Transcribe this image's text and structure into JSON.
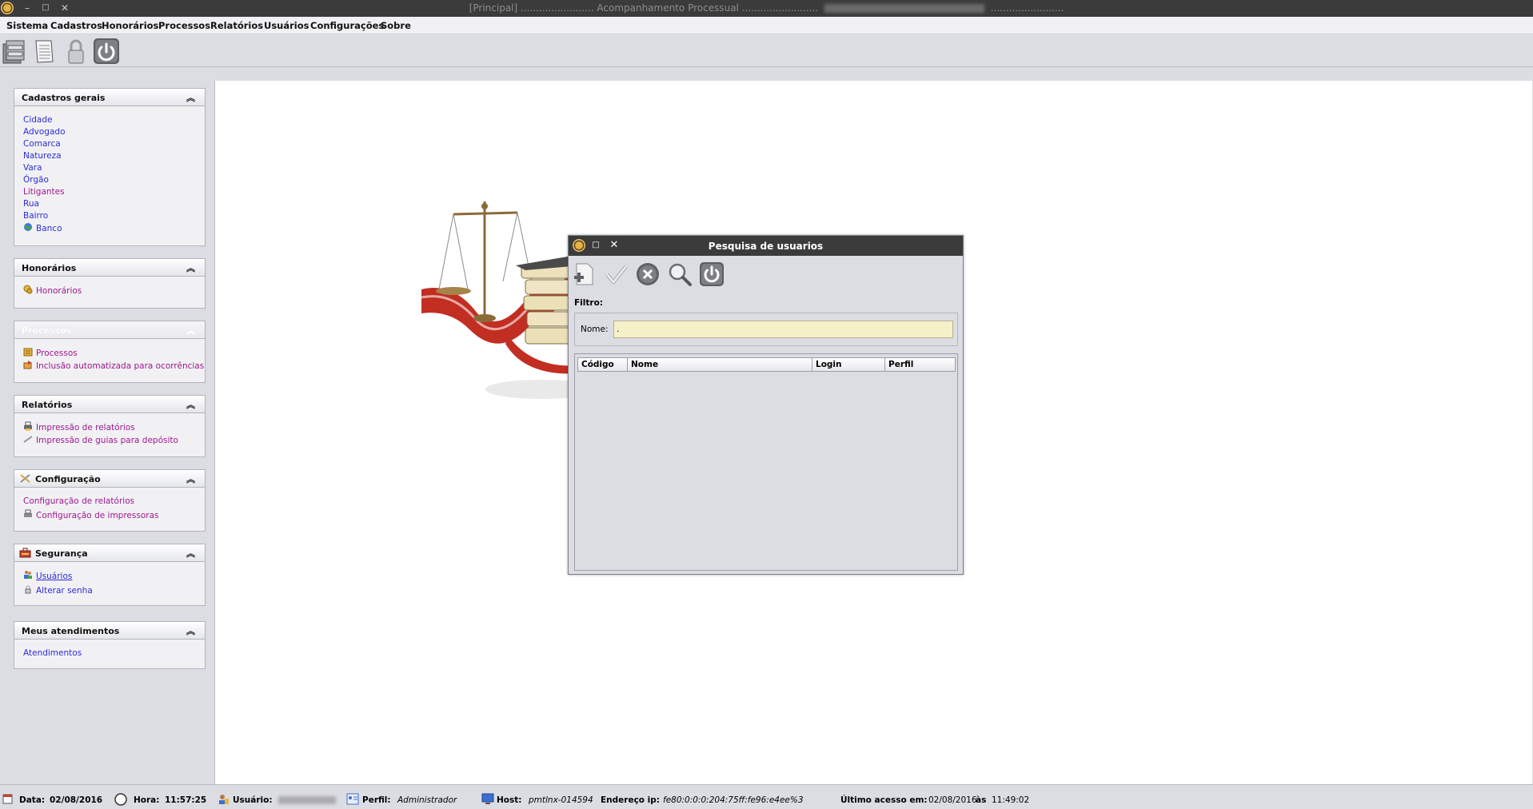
{
  "window": {
    "title_left": "[Principal] ........................ Acompanhamento Processual .........................",
    "title_right": "........................"
  },
  "menu": [
    "Sistema",
    "Cadastros",
    "Honorários",
    "Processos",
    "Relatórios",
    "Usuários",
    "Configurações",
    "Sobre"
  ],
  "toolbar": {
    "icons": [
      "cabinet-icon",
      "document-icon",
      "lock-icon",
      "power-icon"
    ]
  },
  "sidebar": {
    "cadastros": {
      "title": "Cadastros gerais",
      "items": [
        "Cidade",
        "Advogado",
        "Comarca",
        "Natureza",
        "Vara",
        "Órgão",
        "Litigantes",
        "Rua",
        "Bairro",
        "Banco"
      ]
    },
    "honorarios": {
      "title": "Honorários",
      "items": [
        "Honorários"
      ]
    },
    "processos": {
      "title": "Processos",
      "items": [
        "Processos",
        "Inclusão automatizada para ocorrências"
      ]
    },
    "relatorios": {
      "title": "Relatórios",
      "items": [
        "Impressão de relatórios",
        "Impressão de guias para depósito"
      ]
    },
    "configuracao": {
      "title": "Configuração",
      "items": [
        "Configuração de relatórios",
        "Configuração de impressoras"
      ]
    },
    "seguranca": {
      "title": "Segurança",
      "items": [
        "Usuários",
        "Alterar senha"
      ]
    },
    "atendimentos": {
      "title": "Meus atendimentos",
      "items": [
        "Atendimentos"
      ]
    }
  },
  "dialog": {
    "title": "Pesquisa de usuarios",
    "filter_label": "Filtro:",
    "name_label": "Nome:",
    "name_value": ".",
    "columns": [
      "Código",
      "Nome",
      "Login",
      "Perfil"
    ]
  },
  "status": {
    "date_label": "Data:",
    "date": "02/08/2016",
    "time_label": "Hora:",
    "time": "11:57:25",
    "user_label": "Usuário:",
    "profile_label": "Perfil:",
    "profile": "Administrador",
    "host_label": "Host:",
    "host": "pmtlnx-014594",
    "ip_label": "Endereço ip:",
    "ip": "fe80:0:0:0:204:75ff:fe96:e4ee%3",
    "last_access_label": "Último acesso em:",
    "last_access_date": "02/08/2016",
    "last_access_sep": "às",
    "last_access_time": "11:49:02"
  }
}
